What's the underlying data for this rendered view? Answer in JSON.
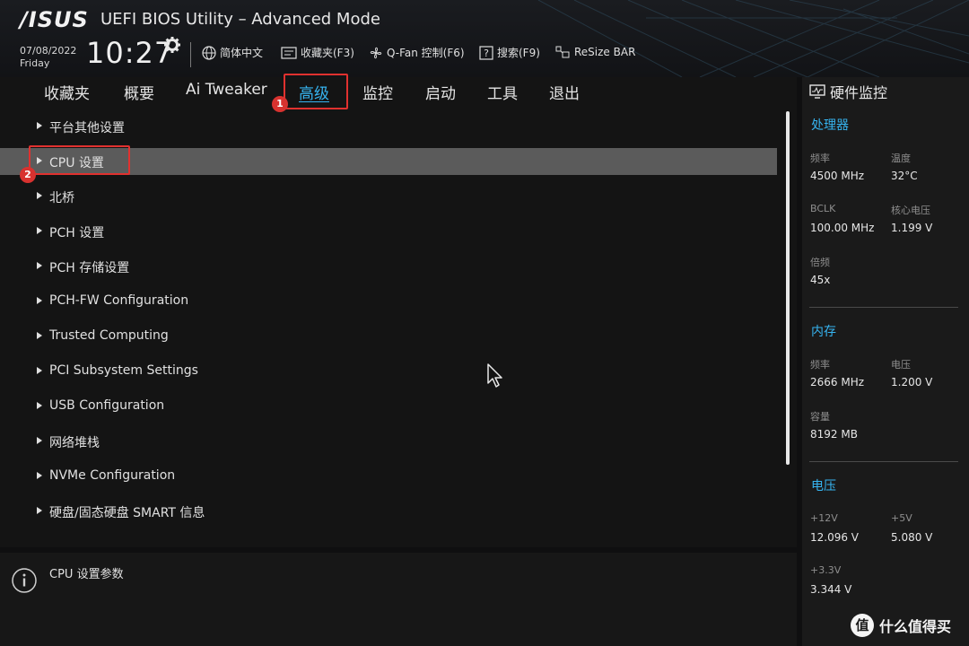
{
  "header": {
    "brand": "/ISUS",
    "title": "UEFI BIOS Utility – Advanced Mode",
    "date": "07/08/2022",
    "day": "Friday",
    "time": "10:27",
    "tools": {
      "language": "简体中文",
      "favorites": "收藏夹(F3)",
      "qfan": "Q-Fan 控制(F6)",
      "search": "搜索(F9)",
      "resizebar": "ReSize BAR"
    }
  },
  "tabs": [
    {
      "label": "收藏夹"
    },
    {
      "label": "概要"
    },
    {
      "label": "Ai Tweaker"
    },
    {
      "label": "高级",
      "active": true
    },
    {
      "label": "监控"
    },
    {
      "label": "启动"
    },
    {
      "label": "工具"
    },
    {
      "label": "退出"
    }
  ],
  "annotations": {
    "tab_marker": "1",
    "item_marker": "2",
    "color": "#e0312f"
  },
  "menu": [
    {
      "label": "平台其他设置"
    },
    {
      "label": "CPU 设置",
      "selected": true
    },
    {
      "label": "北桥"
    },
    {
      "label": "PCH 设置"
    },
    {
      "label": "PCH 存储设置"
    },
    {
      "label": "PCH-FW Configuration"
    },
    {
      "label": "Trusted Computing"
    },
    {
      "label": "PCI Subsystem Settings"
    },
    {
      "label": "USB Configuration"
    },
    {
      "label": "网络堆栈"
    },
    {
      "label": "NVMe Configuration"
    },
    {
      "label": "硬盘/固态硬盘 SMART 信息"
    }
  ],
  "help": {
    "text": "CPU 设置参数",
    "icon": "info-icon"
  },
  "hardware_monitor": {
    "title": "硬件监控",
    "cpu": {
      "title": "处理器",
      "freq_label": "频率",
      "freq": "4500 MHz",
      "temp_label": "温度",
      "temp": "32°C",
      "bclk_label": "BCLK",
      "bclk": "100.00 MHz",
      "vcore_label": "核心电压",
      "vcore": "1.199 V",
      "ratio_label": "倍频",
      "ratio": "45x"
    },
    "memory": {
      "title": "内存",
      "freq_label": "频率",
      "freq": "2666 MHz",
      "volt_label": "电压",
      "volt": "1.200 V",
      "cap_label": "容量",
      "cap": "8192 MB"
    },
    "voltage": {
      "title": "电压",
      "v12_label": "+12V",
      "v12": "12.096 V",
      "v5_label": "+5V",
      "v5": "5.080 V",
      "v33_label": "+3.3V",
      "v33": "3.344 V"
    }
  },
  "watermark": {
    "text": "什么值得买",
    "logo": "值"
  },
  "colors": {
    "accent": "#36b4f0",
    "selected_row": "#5b5b5b",
    "annotation": "#e0312f"
  }
}
